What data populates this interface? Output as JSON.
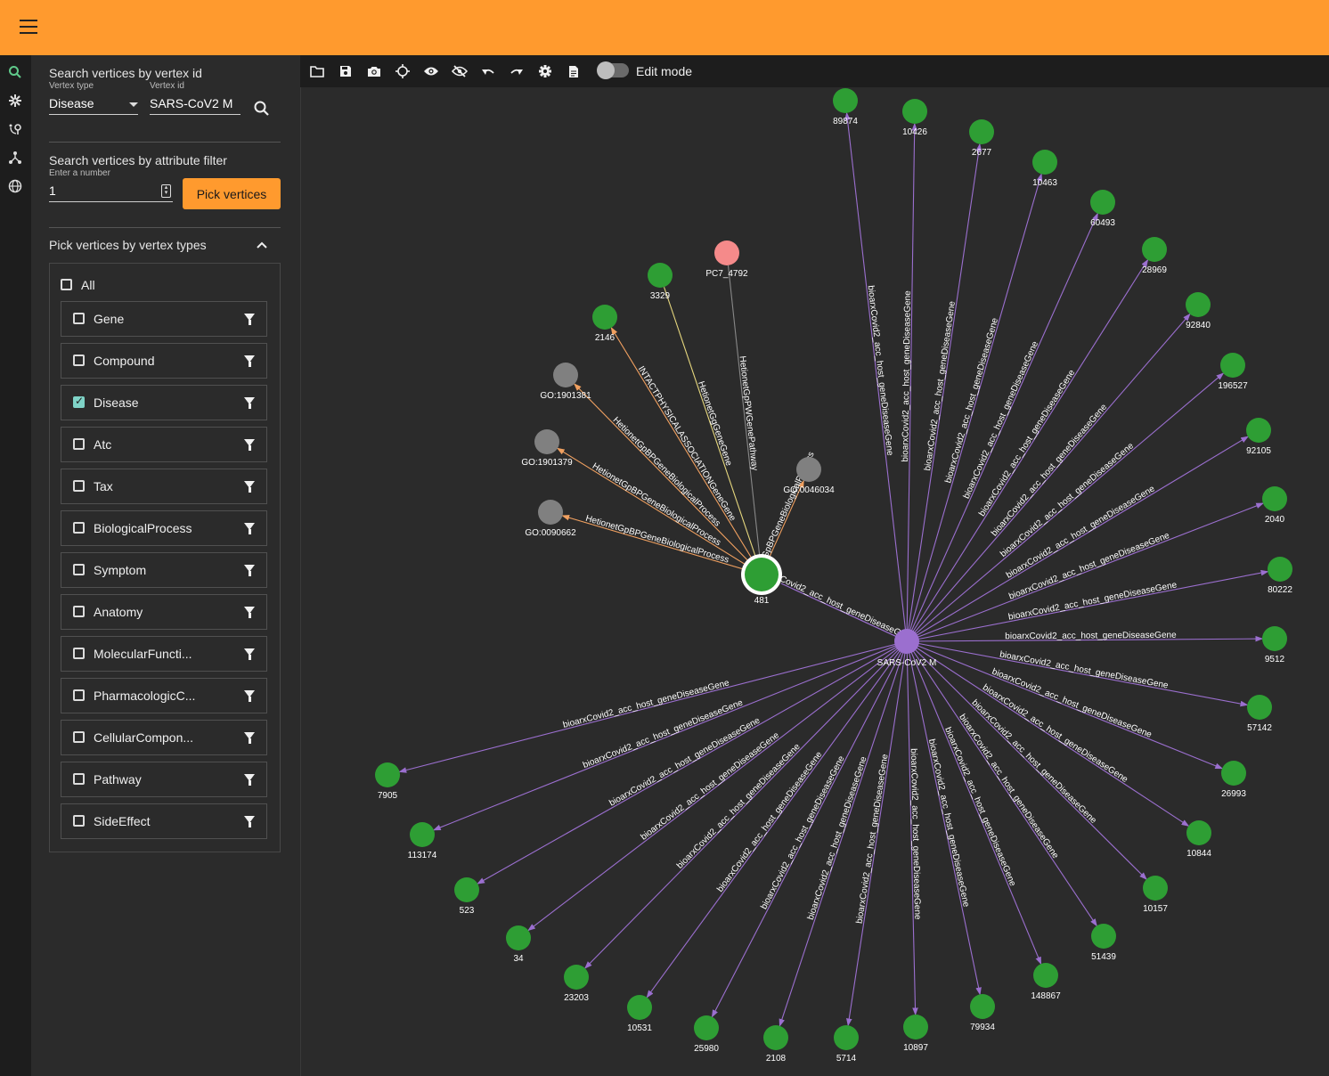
{
  "sidebar": {
    "search_id_title": "Search vertices by vertex id",
    "vertex_type_label": "Vertex type",
    "vertex_type_value": "Disease",
    "vertex_id_label": "Vertex id",
    "vertex_id_value": "SARS-CoV2 M",
    "attr_filter_title": "Search vertices by attribute filter",
    "number_label": "Enter a number",
    "number_value": "1",
    "pick_button": "Pick vertices",
    "types_title": "Pick vertices by vertex types",
    "all_label": "All",
    "types": [
      {
        "label": "Gene",
        "checked": false
      },
      {
        "label": "Compound",
        "checked": false
      },
      {
        "label": "Disease",
        "checked": true
      },
      {
        "label": "Atc",
        "checked": false
      },
      {
        "label": "Tax",
        "checked": false
      },
      {
        "label": "BiologicalProcess",
        "checked": false
      },
      {
        "label": "Symptom",
        "checked": false
      },
      {
        "label": "Anatomy",
        "checked": false
      },
      {
        "label": "MolecularFuncti...",
        "checked": false
      },
      {
        "label": "PharmacologicC...",
        "checked": false
      },
      {
        "label": "CellularCompon...",
        "checked": false
      },
      {
        "label": "Pathway",
        "checked": false
      },
      {
        "label": "SideEffect",
        "checked": false
      }
    ]
  },
  "toolbar": {
    "icons": [
      "folder-icon",
      "save-icon",
      "camera-icon",
      "locate-icon",
      "eye-icon",
      "eye-off-icon",
      "undo-icon",
      "redo-icon",
      "settings-icon",
      "document-icon"
    ],
    "edit_mode_label": "Edit mode"
  },
  "rail_icons": [
    "search-icon",
    "gear-icon",
    "route-icon",
    "graph-icon",
    "globe-icon"
  ],
  "colors": {
    "accent": "#ff9a2e",
    "gene_node": "#2e9e34",
    "disease_node": "#9b6fcf",
    "go_node": "#808080",
    "pathway_node": "#f58a8a",
    "edge_disease": "#9b6fcf",
    "edge_bp": "#f0a060",
    "edge_gg": "#e6d77e",
    "edge_pw": "#888888"
  },
  "graph": {
    "center": {
      "label": "SARS-CoV2 M"
    },
    "hub": {
      "label": "481"
    },
    "disease_edge_label": "bioarxCovid2_acc_host_geneDiseaseGene",
    "hub_edge_label": "bioarxCovid2_acc_host_geneDiseaseGene",
    "disease_neighbors": [
      "89874",
      "10426",
      "2677",
      "10463",
      "60493",
      "28969",
      "92840",
      "196527",
      "92105",
      "2040",
      "80222",
      "9512",
      "57142",
      "26993",
      "10844",
      "10157",
      "51439",
      "148867",
      "79934",
      "10897",
      "5714",
      "2108",
      "25980",
      "10531",
      "23203",
      "34",
      "523",
      "113174",
      "7905"
    ],
    "hub_neighbors": [
      {
        "label": "3329",
        "kind": "gene",
        "edge": "HetionetGgGeneGene"
      },
      {
        "label": "PC7_4792",
        "kind": "pathway",
        "edge": "HetionetGpPWGenePathway"
      },
      {
        "label": "2146",
        "kind": "gene",
        "edge": "INTACTPHYSICALASSOCIATIONGeneGene"
      },
      {
        "label": "GO:1901381",
        "kind": "go",
        "edge": "HetionetGpBPGeneBiologicalProcess"
      },
      {
        "label": "GO:1901379",
        "kind": "go",
        "edge": "HetionetGpBPGeneBiologicalProcess"
      },
      {
        "label": "GO:0090662",
        "kind": "go",
        "edge": "HetionetGpBPGeneBiologicalProcess"
      },
      {
        "label": "GO:0046034",
        "kind": "go",
        "edge": "HetionetGpBPGeneBiologicalProcess"
      }
    ]
  }
}
